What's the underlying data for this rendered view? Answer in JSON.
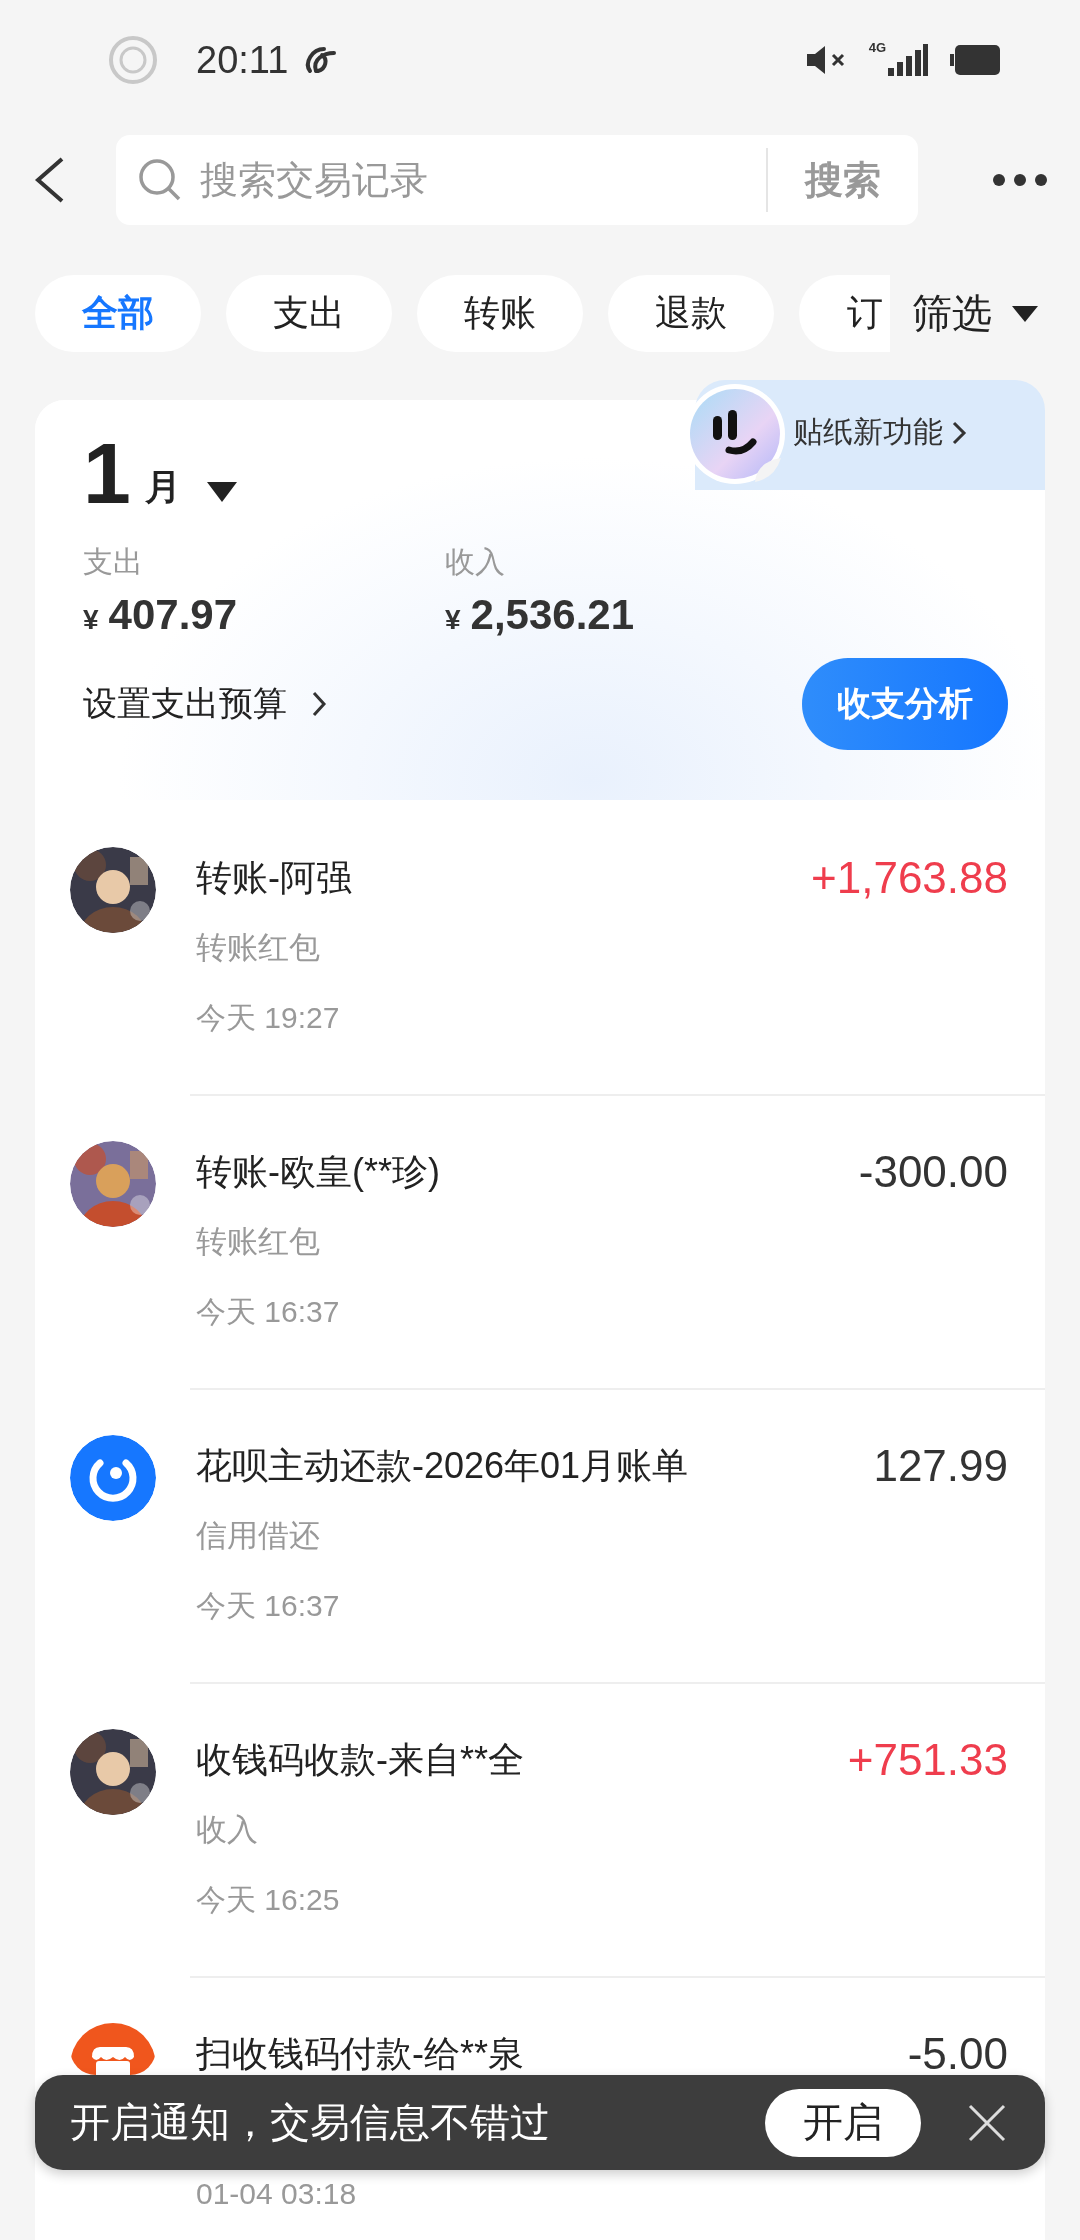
{
  "status_bar": {
    "time": "20:11",
    "network": "4G"
  },
  "search": {
    "placeholder": "搜索交易记录",
    "button": "搜索"
  },
  "filters": [
    {
      "label": "全部",
      "selected": true
    },
    {
      "label": "支出",
      "selected": false
    },
    {
      "label": "转账",
      "selected": false
    },
    {
      "label": "退款",
      "selected": false
    },
    {
      "label": "订",
      "selected": false
    }
  ],
  "filter_button": "筛选",
  "sticker_banner": "贴纸新功能",
  "summary": {
    "month_number": "1",
    "month_unit": "月",
    "expense_label": "支出",
    "expense_currency": "¥",
    "expense": "407.97",
    "income_label": "收入",
    "income_currency": "¥",
    "income": "2,536.21",
    "budget_link": "设置支出预算",
    "analysis_button": "收支分析"
  },
  "transactions": [
    {
      "title": "转账-阿强",
      "category": "转账红包",
      "time": "今天 19:27",
      "amount": "+1,763.88",
      "positive": true
    },
    {
      "title": "转账-欧皇(**珍)",
      "category": "转账红包",
      "time": "今天 16:37",
      "amount": "-300.00",
      "positive": false
    },
    {
      "kind": "credit",
      "title": "花呗主动还款-2026年01月账单",
      "category": "信用借还",
      "time": "今天 16:37",
      "amount": "127.99",
      "positive": false
    },
    {
      "title": "收钱码收款-来自**全",
      "category": "收入",
      "time": "今天 16:25",
      "amount": "+751.33",
      "positive": true
    },
    {
      "kind": "store",
      "title": "扫收钱码付款-给**泉",
      "time": "01-04 03:18",
      "amount": "-5.00",
      "positive": false
    }
  ],
  "toast": {
    "message": "开启通知，交易信息不错过",
    "button": "开启"
  }
}
